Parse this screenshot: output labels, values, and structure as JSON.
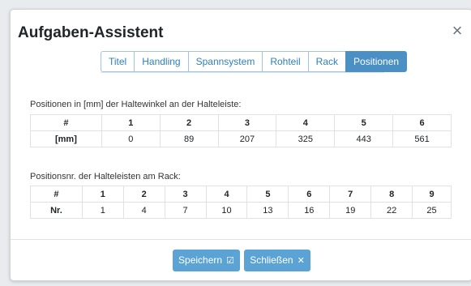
{
  "dialog": {
    "title": "Aufgaben-Assistent",
    "close_icon": "×"
  },
  "tabs": [
    {
      "label": "Titel",
      "active": false
    },
    {
      "label": "Handling",
      "active": false
    },
    {
      "label": "Spannsystem",
      "active": false
    },
    {
      "label": "Rohteil",
      "active": false
    },
    {
      "label": "Rack",
      "active": false
    },
    {
      "label": "Positionen",
      "active": true
    }
  ],
  "positions_section": {
    "label": "Positionen in [mm] der Haltewinkel an der Halteleiste:",
    "header": [
      "#",
      "1",
      "2",
      "3",
      "4",
      "5",
      "6"
    ],
    "row": [
      "[mm]",
      "0",
      "89",
      "207",
      "325",
      "443",
      "561"
    ]
  },
  "rack_section": {
    "label": "Positionsnr. der Halteleisten am Rack:",
    "header": [
      "#",
      "1",
      "2",
      "3",
      "4",
      "5",
      "6",
      "7",
      "8",
      "9"
    ],
    "row": [
      "Nr.",
      "1",
      "4",
      "7",
      "10",
      "13",
      "16",
      "19",
      "22",
      "25"
    ]
  },
  "footer": {
    "save_label": "Speichern",
    "save_icon": "☑",
    "close_label": "Schließen",
    "close_icon": "✕"
  },
  "colors": {
    "accent": "#4a90c4",
    "button": "#5ba3d4"
  }
}
